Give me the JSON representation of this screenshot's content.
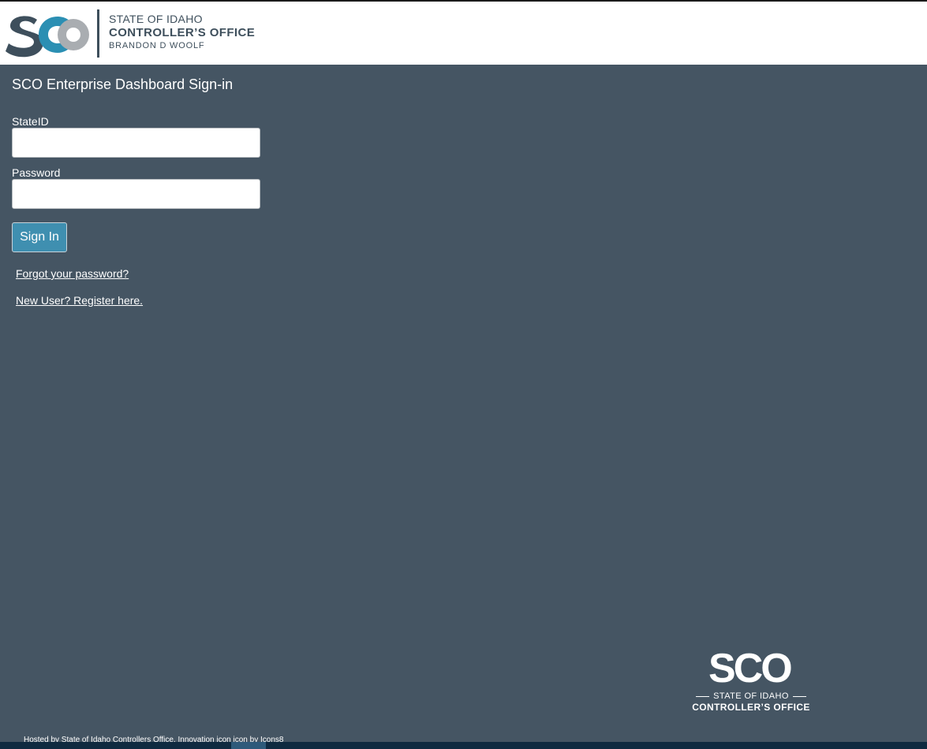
{
  "header": {
    "logo_mark": "SCO",
    "state_line": "STATE OF IDAHO",
    "office_line": "CONTROLLER’S OFFICE",
    "person_line": "BRANDON D WOOLF"
  },
  "form": {
    "title": "SCO Enterprise Dashboard Sign-in",
    "stateid_label": "StateID",
    "stateid_value": "",
    "password_label": "Password",
    "password_value": "",
    "signin_label": "Sign In",
    "forgot_link": "Forgot your password?",
    "register_link": "New User? Register here."
  },
  "footer": {
    "logo_mark": "SCO",
    "state_line": "STATE OF IDAHO",
    "office_line": "CONTROLLER’S OFFICE",
    "hosted_text": "Hosted by State of Idaho Controllers Office. Innovation icon icon by Icons8"
  },
  "colors": {
    "page_bg": "#455563",
    "header_bg": "#ffffff",
    "brand_dark": "#3e4f5c",
    "brand_teal": "#2b8fb3",
    "button_bg": "#3f8fb0"
  }
}
